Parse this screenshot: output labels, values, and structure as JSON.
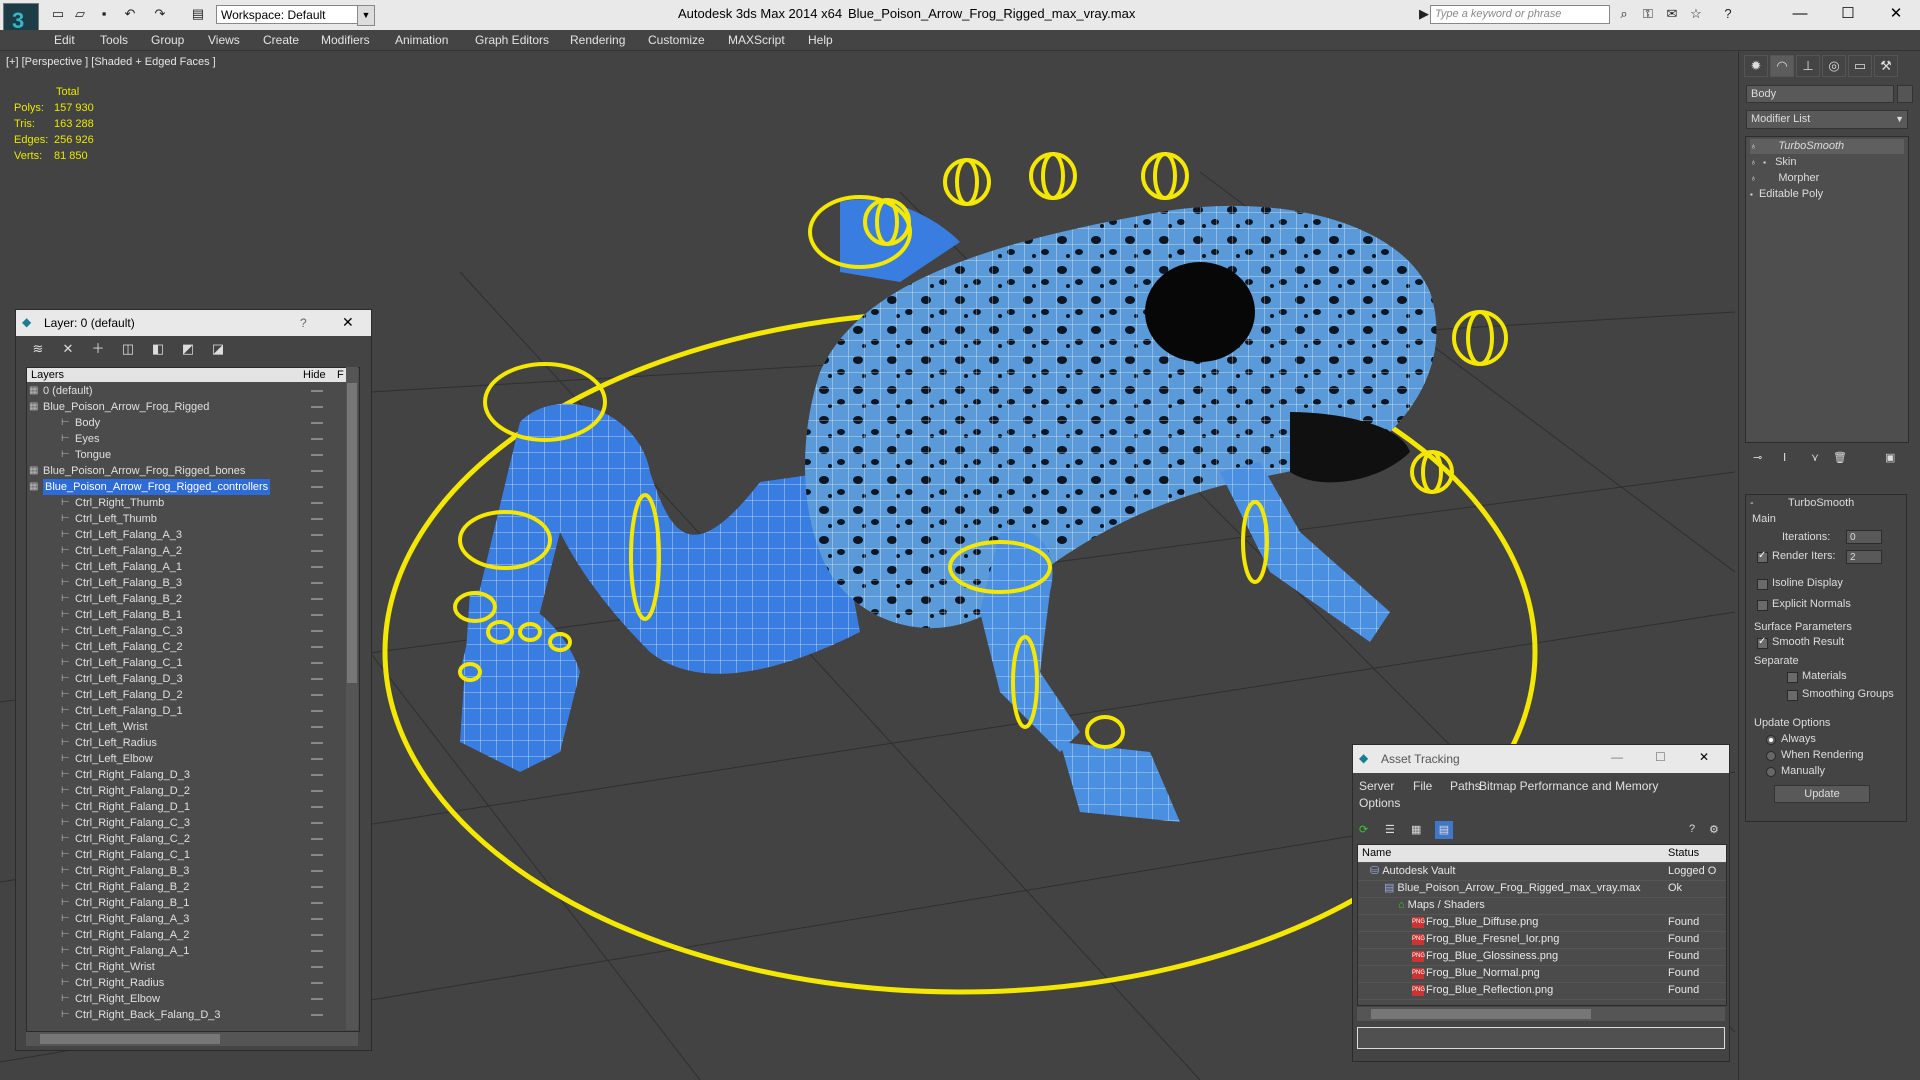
{
  "app": {
    "title": "Autodesk 3ds Max  2014 x64",
    "file": "Blue_Poison_Arrow_Frog_Rigged_max_vray.max",
    "workspace": "Workspace: Default",
    "search_placeholder": "Type a keyword or phrase"
  },
  "menu": [
    "Edit",
    "Tools",
    "Group",
    "Views",
    "Create",
    "Modifiers",
    "Animation",
    "Graph Editors",
    "Rendering",
    "Customize",
    "MAXScript",
    "Help"
  ],
  "viewport": {
    "label": "[+] [Perspective ] [Shaded + Edged Faces ]",
    "stats": {
      "header": "Total",
      "rows": [
        {
          "label": "Polys:",
          "value": "157 930"
        },
        {
          "label": "Tris:",
          "value": "163 288"
        },
        {
          "label": "Edges:",
          "value": "256 926"
        },
        {
          "label": "Verts:",
          "value": "81 850"
        }
      ]
    }
  },
  "command_panel": {
    "object_name": "Body",
    "modifier_list": "Modifier List",
    "stack": [
      "TurboSmooth",
      "Skin",
      "Morpher",
      "Editable Poly"
    ],
    "rollout_title": "TurboSmooth",
    "main_label": "Main",
    "iterations_label": "Iterations:",
    "iterations_value": "0",
    "render_iters_label": "Render Iters:",
    "render_iters_value": "2",
    "isoline": "Isoline Display",
    "explicit": "Explicit Normals",
    "surface_params": "Surface Parameters",
    "smooth_result": "Smooth Result",
    "separate": "Separate",
    "materials": "Materials",
    "smoothing_groups": "Smoothing Groups",
    "update_options": "Update Options",
    "always": "Always",
    "when_rendering": "When Rendering",
    "manually": "Manually",
    "update_btn": "Update"
  },
  "layer_explorer": {
    "title": "Layer: 0 (default)",
    "help": "?",
    "col_layers": "Layers",
    "col_hide": "Hide",
    "col_f": "F",
    "rows": [
      {
        "name": "0 (default)",
        "indent": 0
      },
      {
        "name": "Blue_Poison_Arrow_Frog_Rigged",
        "indent": 0
      },
      {
        "name": "Body",
        "indent": 1
      },
      {
        "name": "Eyes",
        "indent": 1
      },
      {
        "name": "Tongue",
        "indent": 1
      },
      {
        "name": "Blue_Poison_Arrow_Frog_Rigged_bones",
        "indent": 0
      },
      {
        "name": "Blue_Poison_Arrow_Frog_Rigged_controllers",
        "indent": 0,
        "selected": true
      },
      {
        "name": "Ctrl_Right_Thumb",
        "indent": 1
      },
      {
        "name": "Ctrl_Left_Thumb",
        "indent": 1
      },
      {
        "name": "Ctrl_Left_Falang_A_3",
        "indent": 1
      },
      {
        "name": "Ctrl_Left_Falang_A_2",
        "indent": 1
      },
      {
        "name": "Ctrl_Left_Falang_A_1",
        "indent": 1
      },
      {
        "name": "Ctrl_Left_Falang_B_3",
        "indent": 1
      },
      {
        "name": "Ctrl_Left_Falang_B_2",
        "indent": 1
      },
      {
        "name": "Ctrl_Left_Falang_B_1",
        "indent": 1
      },
      {
        "name": "Ctrl_Left_Falang_C_3",
        "indent": 1
      },
      {
        "name": "Ctrl_Left_Falang_C_2",
        "indent": 1
      },
      {
        "name": "Ctrl_Left_Falang_C_1",
        "indent": 1
      },
      {
        "name": "Ctrl_Left_Falang_D_3",
        "indent": 1
      },
      {
        "name": "Ctrl_Left_Falang_D_2",
        "indent": 1
      },
      {
        "name": "Ctrl_Left_Falang_D_1",
        "indent": 1
      },
      {
        "name": "Ctrl_Left_Wrist",
        "indent": 1
      },
      {
        "name": "Ctrl_Left_Radius",
        "indent": 1
      },
      {
        "name": "Ctrl_Left_Elbow",
        "indent": 1
      },
      {
        "name": "Ctrl_Right_Falang_D_3",
        "indent": 1
      },
      {
        "name": "Ctrl_Right_Falang_D_2",
        "indent": 1
      },
      {
        "name": "Ctrl_Right_Falang_D_1",
        "indent": 1
      },
      {
        "name": "Ctrl_Right_Falang_C_3",
        "indent": 1
      },
      {
        "name": "Ctrl_Right_Falang_C_2",
        "indent": 1
      },
      {
        "name": "Ctrl_Right_Falang_C_1",
        "indent": 1
      },
      {
        "name": "Ctrl_Right_Falang_B_3",
        "indent": 1
      },
      {
        "name": "Ctrl_Right_Falang_B_2",
        "indent": 1
      },
      {
        "name": "Ctrl_Right_Falang_B_1",
        "indent": 1
      },
      {
        "name": "Ctrl_Right_Falang_A_3",
        "indent": 1
      },
      {
        "name": "Ctrl_Right_Falang_A_2",
        "indent": 1
      },
      {
        "name": "Ctrl_Right_Falang_A_1",
        "indent": 1
      },
      {
        "name": "Ctrl_Right_Wrist",
        "indent": 1
      },
      {
        "name": "Ctrl_Right_Radius",
        "indent": 1
      },
      {
        "name": "Ctrl_Right_Elbow",
        "indent": 1
      },
      {
        "name": "Ctrl_Right_Back_Falang_D_3",
        "indent": 1
      }
    ]
  },
  "asset_tracking": {
    "title": "Asset Tracking",
    "menu": [
      "Server",
      "File",
      "Paths",
      "Bitmap Performance and Memory",
      "Options"
    ],
    "col_name": "Name",
    "col_status": "Status",
    "rows": [
      {
        "name": "Autodesk Vault",
        "status": "Logged O",
        "indent": 1,
        "icon": "vault"
      },
      {
        "name": "Blue_Poison_Arrow_Frog_Rigged_max_vray.max",
        "status": "Ok",
        "indent": 2,
        "icon": "max"
      },
      {
        "name": "Maps / Shaders",
        "status": "",
        "indent": 3,
        "icon": "folder"
      },
      {
        "name": "Frog_Blue_Diffuse.png",
        "status": "Found",
        "indent": 4,
        "icon": "png"
      },
      {
        "name": "Frog_Blue_Fresnel_Ior.png",
        "status": "Found",
        "indent": 4,
        "icon": "png"
      },
      {
        "name": "Frog_Blue_Glossiness.png",
        "status": "Found",
        "indent": 4,
        "icon": "png"
      },
      {
        "name": "Frog_Blue_Normal.png",
        "status": "Found",
        "indent": 4,
        "icon": "png"
      },
      {
        "name": "Frog_Blue_Reflection.png",
        "status": "Found",
        "indent": 4,
        "icon": "png"
      }
    ]
  },
  "colors": {
    "accent": "#2d6bd6",
    "controller": "#f5e800",
    "frog": "#3a8fe0"
  }
}
